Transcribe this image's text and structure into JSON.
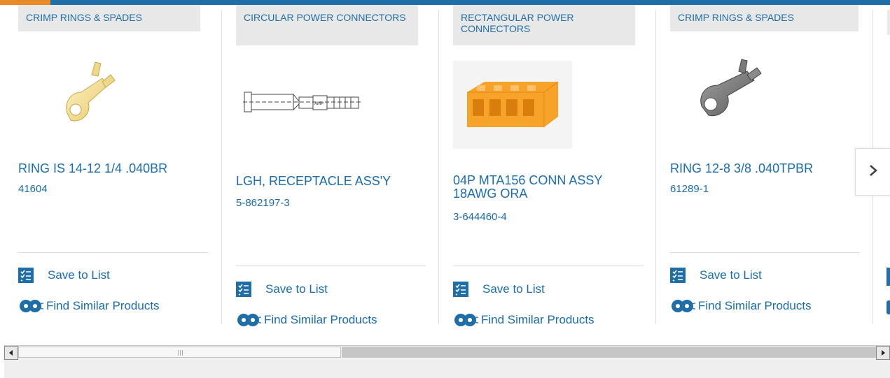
{
  "cards": [
    {
      "category": "CRIMP RINGS & SPADES",
      "title": "RING IS 14-12 1/4 .040BR",
      "part_number": "41604",
      "image_icon": "gold-ring-terminal-image",
      "save_label": "Save to List",
      "similar_label": "Find Similar Products"
    },
    {
      "category": "CIRCULAR POWER CONNECTORS",
      "title": "LGH, RECEPTACLE ASS'Y",
      "part_number": "5-862197-3",
      "image_icon": "receptacle-drawing-image",
      "image_text": "AMP",
      "save_label": "Save to List",
      "similar_label": "Find Similar Products"
    },
    {
      "category": "RECTANGULAR POWER CONNECTORS",
      "title": "04P MTA156 CONN ASSY 18AWG ORA",
      "part_number": "3-644460-4",
      "image_icon": "orange-connector-image",
      "save_label": "Save to List",
      "similar_label": "Find Similar Products"
    },
    {
      "category": "CRIMP RINGS & SPADES",
      "title": "RING 12-8 3/8 .040TPBR",
      "part_number": "61289-1",
      "image_icon": "gray-ring-terminal-image",
      "save_label": "Save to List",
      "similar_label": "Find Similar Products"
    }
  ],
  "colors": {
    "accent": "#1f6ea8",
    "highlight": "#e88a25",
    "link": "#1a6cb0",
    "category_bg": "#e8e8e8"
  },
  "next_button_icon": "chevron-right-icon",
  "scrollbar": {
    "position_fraction": 0.0,
    "visible_fraction": 0.37
  }
}
